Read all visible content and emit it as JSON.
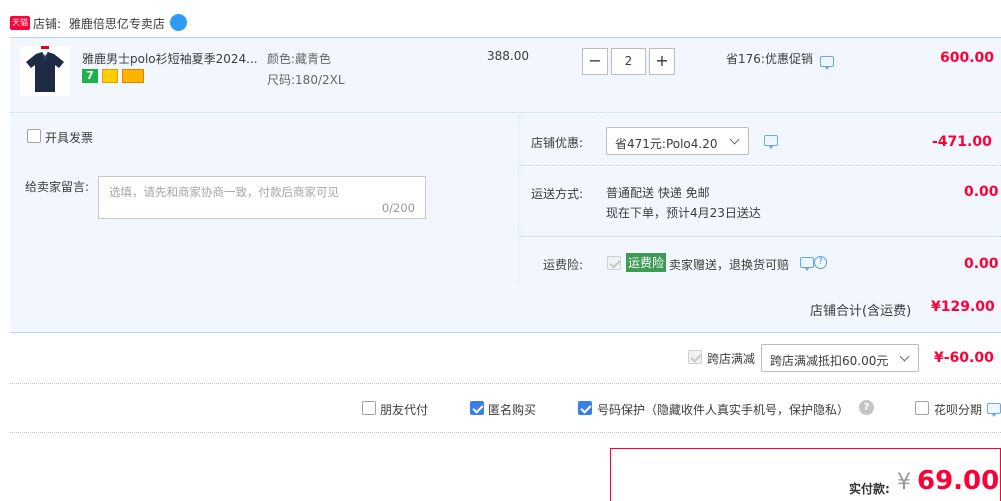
{
  "shop": {
    "badge": "天猫",
    "prefix": "店铺:",
    "name": "雅鹿倍思亿专卖店"
  },
  "item": {
    "title": "雅鹿男士polo衫短袖夏季2024...",
    "color_label": "颜色:",
    "color_value": "藏青色",
    "size_label": "尺码:",
    "size_value": "180/2XL",
    "price": "388.00",
    "quantity": "2",
    "minus": "−",
    "plus": "+",
    "promo": "省176:优惠促销",
    "subtotal": "600.00",
    "tag7": "7"
  },
  "invoice": {
    "label": "开具发票"
  },
  "message": {
    "label": "给卖家留言:",
    "placeholder": "选填，请先和商家协商一致，付款后商家可见",
    "counter": "0/200"
  },
  "discount": {
    "label": "店铺优惠:",
    "selected": "省471元:Polo4.20",
    "amount": "-471.00"
  },
  "delivery": {
    "label": "运送方式:",
    "method": "普通配送 快递 免邮",
    "eta": "现在下单，预计4月23日送达",
    "amount": "0.00"
  },
  "insurance": {
    "label": "运费险:",
    "badge": "运费险",
    "text": "卖家赠送，退换货可赔",
    "amount": "0.00"
  },
  "shop_total": {
    "label": "店铺合计(含运费)",
    "amount": "¥129.00"
  },
  "cross_store": {
    "label": "跨店满减",
    "selected": "跨店满减抵扣60.00元",
    "amount": "¥-60.00"
  },
  "options": {
    "friend_pay": "朋友代付",
    "anonymous": "匿名购买",
    "number_protect": "号码保护（隐藏收件人真实手机号，保护隐私）",
    "huabei": "花呗分期"
  },
  "payment": {
    "label": "实付款:",
    "currency": "¥",
    "amount": "69.00"
  },
  "colors": {
    "accent_red": "#ff0036",
    "panel_blue": "#f2f7ff",
    "border_blue": "#b2d1ff",
    "checkbox_blue": "#3b7fe3",
    "insurance_green": "#3d9b54"
  }
}
